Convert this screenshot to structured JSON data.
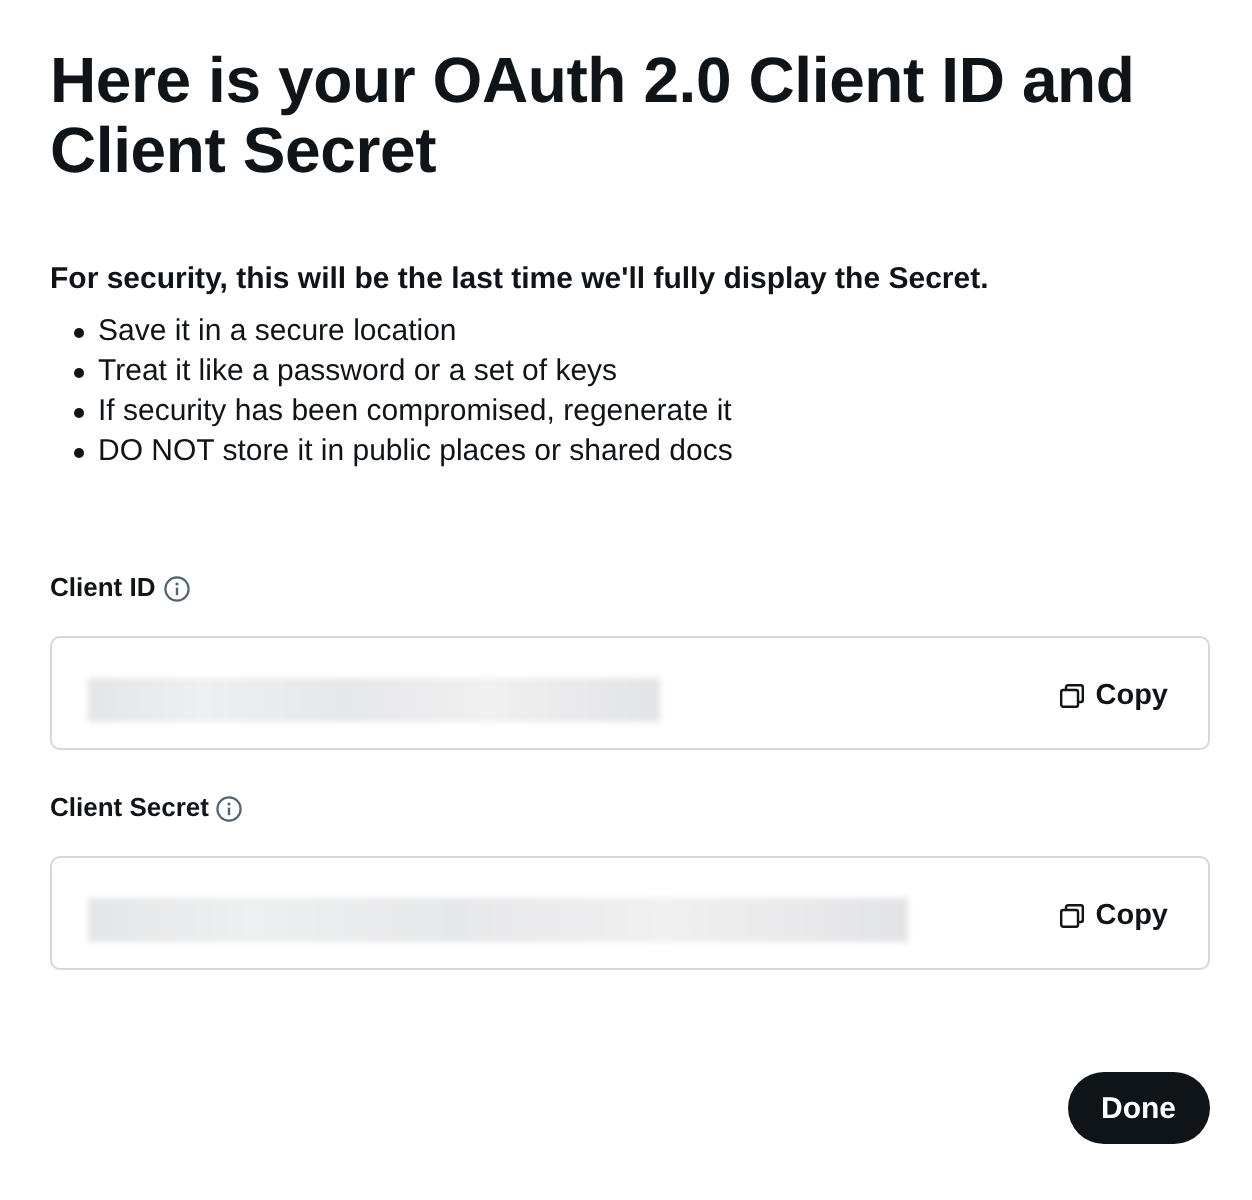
{
  "title": "Here is your OAuth 2.0 Client ID and Client Secret",
  "notice": {
    "heading": "For security, this will be the last time we'll fully display the Secret.",
    "bullets": [
      "Save it in a secure location",
      "Treat it like a password or a set of keys",
      "If security has been compromised, regenerate it",
      "DO NOT store it in public places or shared docs"
    ]
  },
  "fields": [
    {
      "label": "Client ID",
      "copy_button": "Copy"
    },
    {
      "label": "Client Secret",
      "copy_button": "Copy"
    }
  ],
  "done_button": "Done"
}
